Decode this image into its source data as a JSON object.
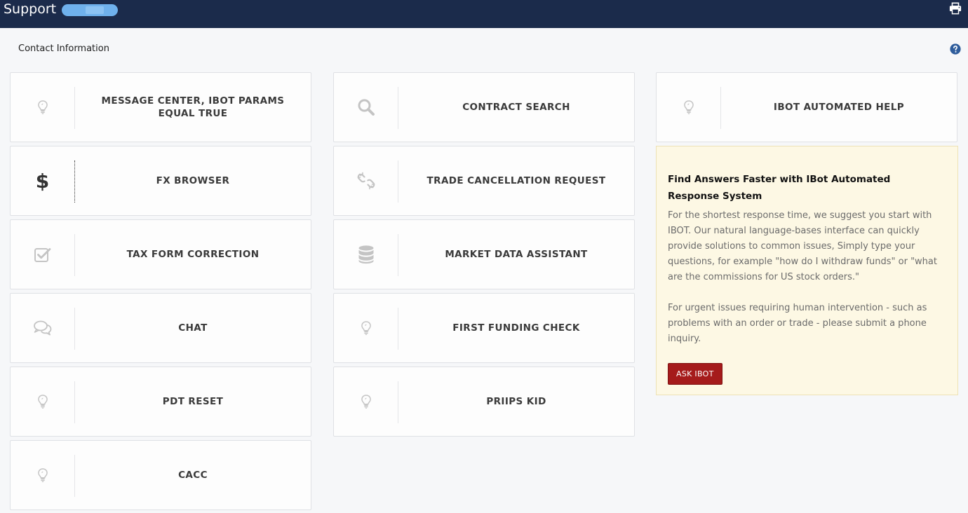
{
  "header": {
    "title": "Support",
    "print_icon": "printer-icon"
  },
  "page": {
    "section_title": "Contact Information",
    "help_icon": "question-circle-icon"
  },
  "colors": {
    "topbar": "#1b2b4b",
    "panel_bg": "#fdf8e4",
    "ask_button": "#a51b1b",
    "icon_gray": "#c4c4c4"
  },
  "tiles": {
    "message_center": {
      "label": "MESSAGE CENTER, IBOT PARAMS EQUAL TRUE",
      "icon": "lightbulb-icon"
    },
    "fx_browser": {
      "label": "FX BROWSER",
      "icon": "dollar-icon"
    },
    "tax_form_correction": {
      "label": "TAX FORM CORRECTION",
      "icon": "checkbox-icon"
    },
    "chat": {
      "label": "CHAT",
      "icon": "chat-bubbles-icon"
    },
    "pdt_reset": {
      "label": "PDT RESET",
      "icon": "lightbulb-icon"
    },
    "cacc": {
      "label": "CACC",
      "icon": "lightbulb-icon"
    },
    "contract_search": {
      "label": "CONTRACT SEARCH",
      "icon": "search-icon"
    },
    "trade_cancellation": {
      "label": "TRADE CANCELLATION REQUEST",
      "icon": "broken-link-icon"
    },
    "market_data_assistant": {
      "label": "MARKET DATA ASSISTANT",
      "icon": "database-icon"
    },
    "first_funding_check": {
      "label": "FIRST FUNDING CHECK",
      "icon": "lightbulb-icon"
    },
    "priips_kid": {
      "label": "PRIIPS KID",
      "icon": "lightbulb-icon"
    },
    "ibot_automated_help": {
      "label": "IBOT AUTOMATED HELP",
      "icon": "lightbulb-icon"
    }
  },
  "ibot_panel": {
    "title": "Find Answers Faster with IBot Automated Response System",
    "paragraph1": "For the shortest response time, we suggest you start with IBOT. Our natural language-bases interface can quickly provide solutions to common issues, Simply type your questions, for example \"how do I withdraw funds\" or \"what are the commissions for US stock orders.\"",
    "paragraph2": "For urgent issues requiring human intervention - such as problems with an order or trade - please submit a phone inquiry.",
    "button_label": "ASK IBOT"
  }
}
